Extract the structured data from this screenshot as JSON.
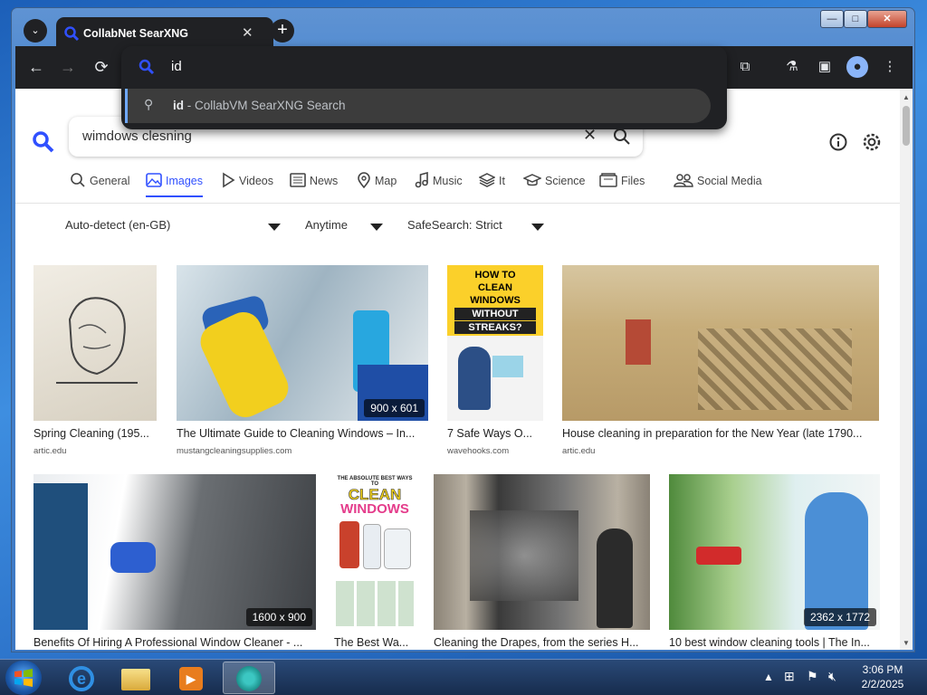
{
  "browser": {
    "tab_title": "CollabNet SearXNG",
    "tab_close": "✕",
    "new_tab": "+",
    "window_controls": {
      "minimize": "—",
      "maximize": "□",
      "close": "✕"
    }
  },
  "omnibox": {
    "value": "id",
    "suggestion_query": "id",
    "suggestion_suffix": " - CollabVM SearXNG Search"
  },
  "search": {
    "query": "wimdows clesning"
  },
  "categories": [
    {
      "label": "General",
      "icon": "search-icon"
    },
    {
      "label": "Images",
      "icon": "image-icon",
      "active": true
    },
    {
      "label": "Videos",
      "icon": "play-icon"
    },
    {
      "label": "News",
      "icon": "newspaper-icon"
    },
    {
      "label": "Map",
      "icon": "map-pin-icon"
    },
    {
      "label": "Music",
      "icon": "music-note-icon"
    },
    {
      "label": "It",
      "icon": "layers-icon"
    },
    {
      "label": "Science",
      "icon": "school-icon"
    },
    {
      "label": "Files",
      "icon": "files-icon"
    },
    {
      "label": "Social Media",
      "icon": "people-icon"
    }
  ],
  "filters": {
    "language": "Auto-detect (en-GB)",
    "time": "Anytime",
    "safesearch": "SafeSearch: Strict"
  },
  "results": [
    {
      "title": "Spring Cleaning (195...",
      "source": "artic.edu",
      "dimensions": ""
    },
    {
      "title": "The Ultimate Guide to Cleaning Windows – In...",
      "source": "mustangcleaningsupplies.com",
      "dimensions": "900 x 601"
    },
    {
      "title": "7 Safe Ways O...",
      "source": "wavehooks.com",
      "dimensions": "",
      "overlay": [
        "HOW TO",
        "CLEAN",
        "WINDOWS",
        "WITHOUT",
        "STREAKS?"
      ]
    },
    {
      "title": "House cleaning in preparation for the New Year (late 1790...",
      "source": "artic.edu",
      "dimensions": ""
    },
    {
      "title": "Benefits Of Hiring A Professional Window Cleaner - ...",
      "source": "",
      "dimensions": "1600 x 900"
    },
    {
      "title": "The Best Wa...",
      "source": "",
      "dimensions": "",
      "overlay": [
        "THE ABSOLUTE BEST WAYS TO",
        "CLEAN",
        "WINDOWS"
      ]
    },
    {
      "title": "Cleaning the Drapes, from the series H...",
      "source": "",
      "dimensions": ""
    },
    {
      "title": "10 best window cleaning tools | The In...",
      "source": "",
      "dimensions": "2362 x 1772"
    }
  ],
  "taskbar": {
    "time": "3:06 PM",
    "date": "2/2/2025"
  },
  "colors": {
    "accent": "#3050ff",
    "chrome_dark": "#202124"
  }
}
